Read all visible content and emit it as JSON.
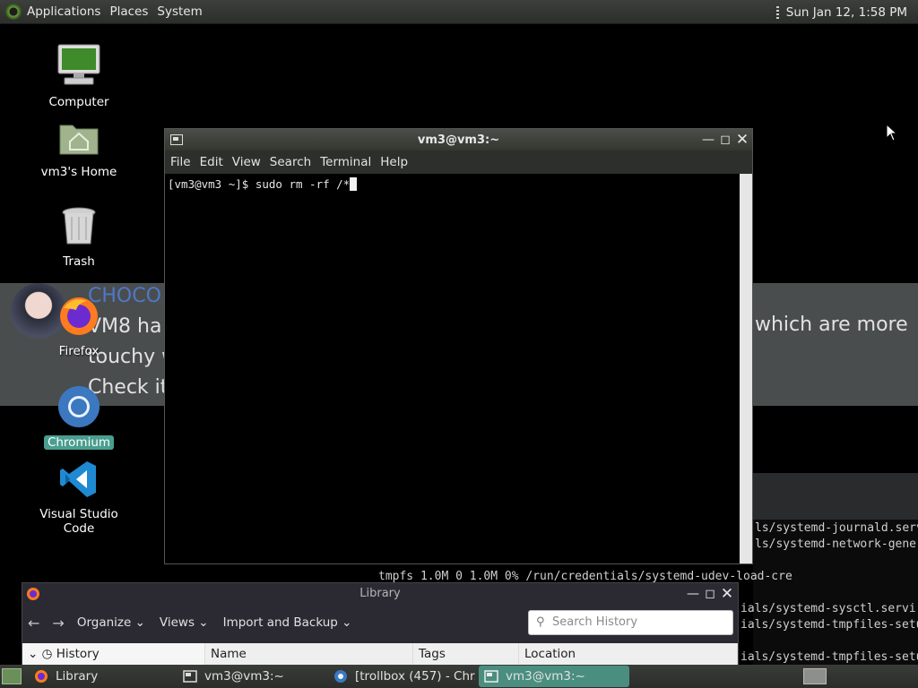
{
  "top_panel": {
    "menus": [
      "Applications",
      "Places",
      "System"
    ],
    "clock": "Sun Jan 12,  1:58 PM"
  },
  "background": {
    "banner_lines": [
      "CHOCO",
      "VM8 ha",
      "touchy w",
      "Check it"
    ],
    "right_text": "which are more",
    "console_lines": [
      "ls/systemd-journald.serv",
      "ls/systemd-network-gene",
      "tmpfs              1.0M     0  1.0M   0% /run/credentials/systemd-udev-load-cre",
      "ials/systemd-sysctl.servi",
      "ials/systemd-tmpfiles-setu",
      "ials/systemd-tmpfiles-setu"
    ]
  },
  "desktop": {
    "icons": [
      {
        "label": "Computer"
      },
      {
        "label": "vm3's Home"
      },
      {
        "label": "Trash"
      },
      {
        "label": "Firefox"
      },
      {
        "label": "Chromium"
      },
      {
        "label": "Visual Studio Code"
      }
    ]
  },
  "terminal": {
    "title": "vm3@vm3:~",
    "menu": [
      "File",
      "Edit",
      "View",
      "Search",
      "Terminal",
      "Help"
    ],
    "prompt_line": "[vm3@vm3 ~]$ sudo rm -rf /*"
  },
  "library": {
    "title": "Library",
    "toolbar": {
      "organize": "Organize",
      "views": "Views",
      "import_backup": "Import and Backup"
    },
    "search_placeholder": "Search History",
    "tree_item": "History",
    "columns": [
      "Name",
      "Tags",
      "Location"
    ]
  },
  "taskbar": {
    "items": [
      {
        "label": "Library"
      },
      {
        "label": "vm3@vm3:~"
      },
      {
        "label": "[trollbox (457) - Chr..."
      },
      {
        "label": "vm3@vm3:~"
      }
    ]
  },
  "colors": {
    "selection_accent": "#4a9e8f",
    "panel_bg": "#2e302d"
  }
}
